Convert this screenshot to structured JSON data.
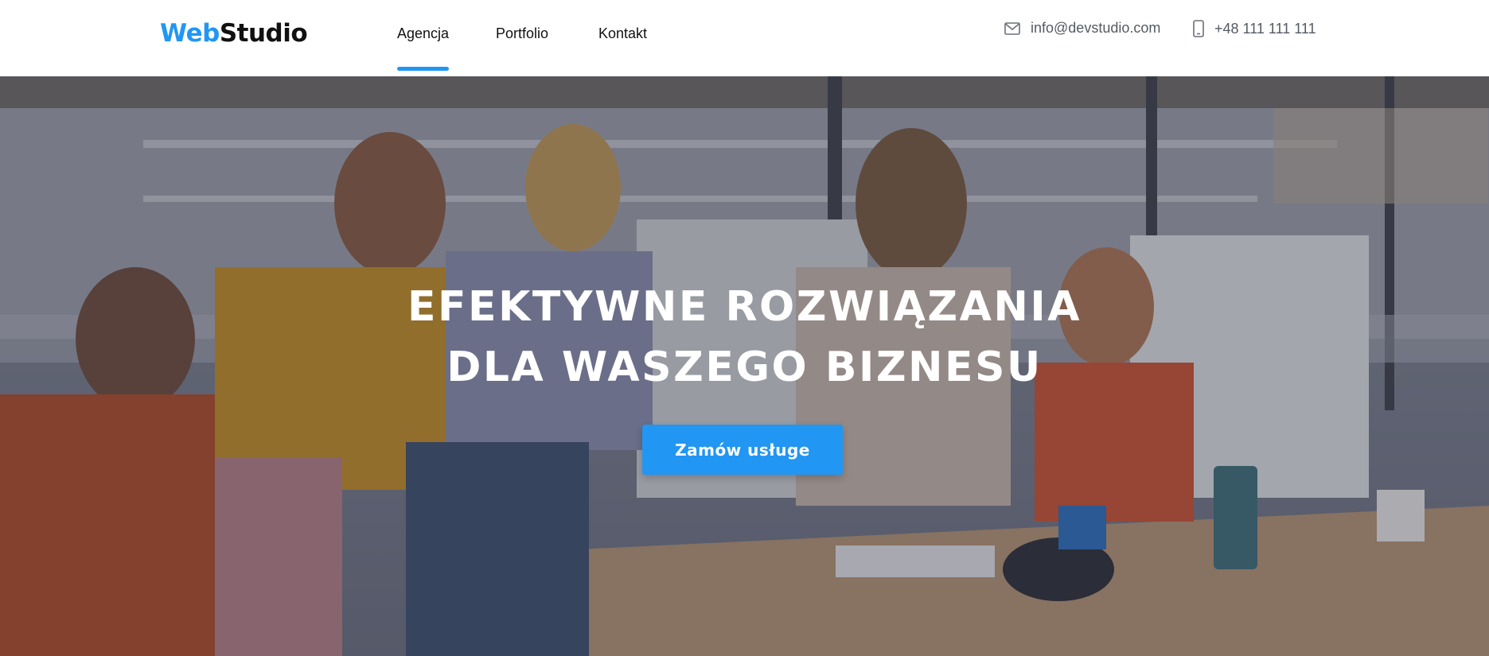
{
  "header": {
    "logo_part1": "Web",
    "logo_part2": "Studio",
    "nav": [
      {
        "label": "Agencja",
        "active": true
      },
      {
        "label": "Portfolio",
        "active": false
      },
      {
        "label": "Kontakt",
        "active": false
      }
    ],
    "email": {
      "icon": "mail-icon",
      "text": "info@devstudio.com"
    },
    "phone": {
      "icon": "phone-icon",
      "text": "+48 111 111 111"
    }
  },
  "hero": {
    "title_line1": "EFEKTYWNE ROZWIĄZANIA",
    "title_line2": "DLA WASZEGO BIZNESU",
    "cta_label": "Zamów usługe"
  },
  "colors": {
    "accent": "#2196f3",
    "text_dark": "#111111",
    "text_muted": "#555a63"
  }
}
